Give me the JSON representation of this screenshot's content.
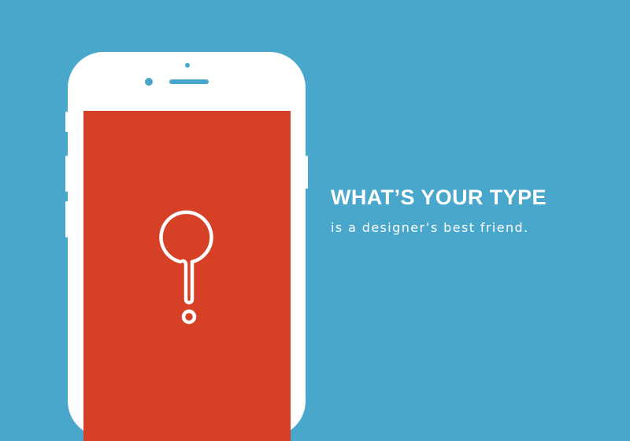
{
  "colors": {
    "background": "#48a7cb",
    "phone_body": "#ffffff",
    "phone_details": "#48a7cb",
    "screen": "#d64027",
    "icon_stroke": "#ffffff",
    "text": "#ffffff"
  },
  "tagline": {
    "headline": "WHAT’S YOUR TYPE",
    "subhead": "is a designer’s best friend."
  },
  "phone": {
    "screen_icon": "question-mark-icon"
  }
}
